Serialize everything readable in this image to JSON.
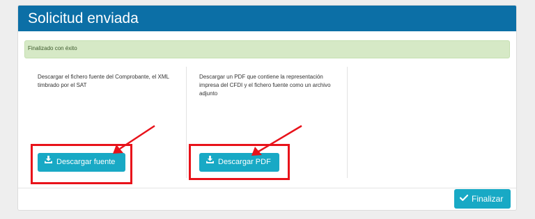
{
  "header": {
    "title": "Solicitud enviada"
  },
  "alert": {
    "text": "Finalizado con éxito"
  },
  "columns": [
    {
      "description": "Descargar el fichero fuente del Comprobante, el XML timbrado por el SAT",
      "button_label": "Descargar fuente",
      "button_icon": "download-icon"
    },
    {
      "description": "Descargar un PDF que contiene la representación impresa del CFDI y el fichero fuente como un archivo adjunto",
      "button_label": "Descargar PDF",
      "button_icon": "download-icon"
    }
  ],
  "footer": {
    "finalize_label": "Finalizar",
    "finalize_icon": "check-icon"
  },
  "colors": {
    "header": "#0c6fa6",
    "accent": "#18a9c5",
    "alert_bg": "#d6e9c6",
    "annotation": "#e8121a"
  }
}
